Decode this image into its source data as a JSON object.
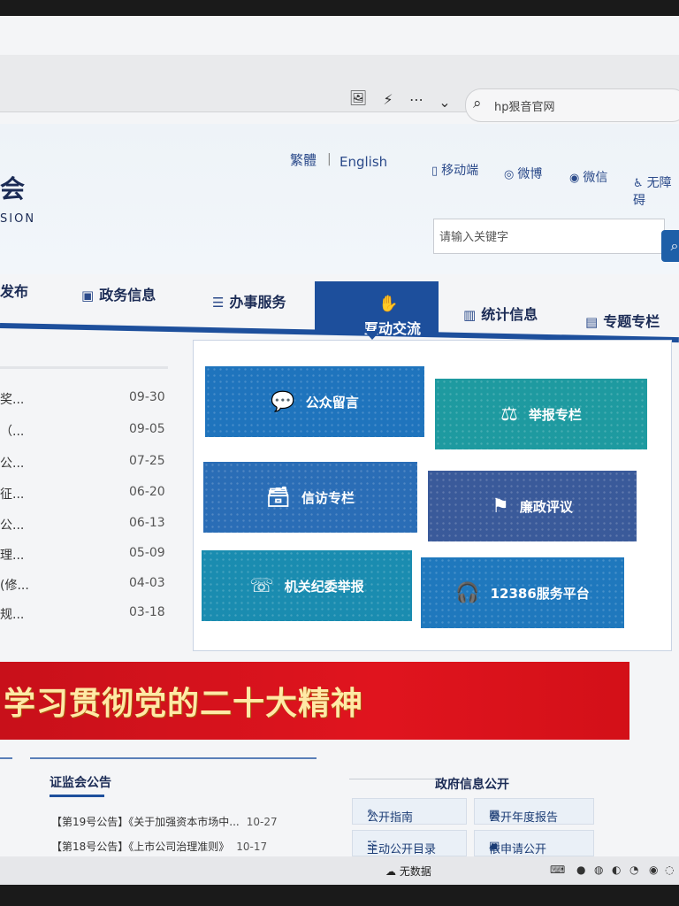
{
  "browser": {
    "toolbar_icons": [
      "image-icon",
      "bolt-icon",
      "more-icon",
      "chevron-down-icon"
    ],
    "search_text": "hp狠音官网"
  },
  "header": {
    "logo_cn": "会",
    "logo_en": "SION",
    "lang_traditional": "繁體",
    "lang_sep": "|",
    "lang_english": "English",
    "links": [
      {
        "label": "移动端",
        "icon": "mobile-icon"
      },
      {
        "label": "微博",
        "icon": "weibo-icon"
      },
      {
        "label": "微信",
        "icon": "wechat-icon"
      },
      {
        "label": "无障碍",
        "icon": "accessibility-icon"
      }
    ],
    "search_placeholder": "请输入关键字"
  },
  "nav": {
    "items": [
      {
        "label": "发布"
      },
      {
        "label": "政务信息",
        "icon": "monitor-icon"
      },
      {
        "label": "办事服务",
        "icon": "document-icon"
      },
      {
        "label": "互动交流",
        "icon": "chat-icon",
        "active": true
      },
      {
        "label": "统计信息",
        "icon": "bar-chart-icon"
      },
      {
        "label": "专题专栏",
        "icon": "note-icon"
      }
    ],
    "accent": "#1d4f9c"
  },
  "news_list": [
    {
      "title": "奖...",
      "date": "09-30"
    },
    {
      "title": "（...",
      "date": "09-05"
    },
    {
      "title": "公...",
      "date": "07-25"
    },
    {
      "title": "征...",
      "date": "06-20"
    },
    {
      "title": "公...",
      "date": "06-13"
    },
    {
      "title": "理...",
      "date": "05-09"
    },
    {
      "title": "(修...",
      "date": "04-03"
    },
    {
      "title": "规...",
      "date": "03-18"
    }
  ],
  "tiles": [
    {
      "label": "公众留言",
      "icon": "speech-bubble-icon"
    },
    {
      "label": "举报专栏",
      "icon": "justice-shield-icon"
    },
    {
      "label": "信访专栏",
      "icon": "inbox-icon"
    },
    {
      "label": "廉政评议",
      "icon": "flag-icon"
    },
    {
      "label": "机关纪委举报",
      "icon": "phone-icon"
    },
    {
      "label": "12386服务平台",
      "icon": "headset-icon"
    }
  ],
  "banner": {
    "text": "学习贯彻党的二十大精神"
  },
  "announcements": {
    "title": "证监会公告",
    "items": [
      {
        "text": "【第19号公告】《关于加强资本市场中...",
        "date": "10-27"
      },
      {
        "text": "【第18号公告】《上市公司治理准则》",
        "date": "10-17"
      }
    ]
  },
  "gov_info": {
    "title": "政府信息公开",
    "buttons": [
      {
        "label": "公开指南",
        "icon": "guide-icon"
      },
      {
        "label": "公开年度报告",
        "icon": "report-icon"
      },
      {
        "label": "主动公开目录",
        "icon": "list-icon"
      },
      {
        "label": "依申请公开",
        "icon": "apply-icon"
      }
    ]
  },
  "taskbar": {
    "network": "无数据"
  }
}
